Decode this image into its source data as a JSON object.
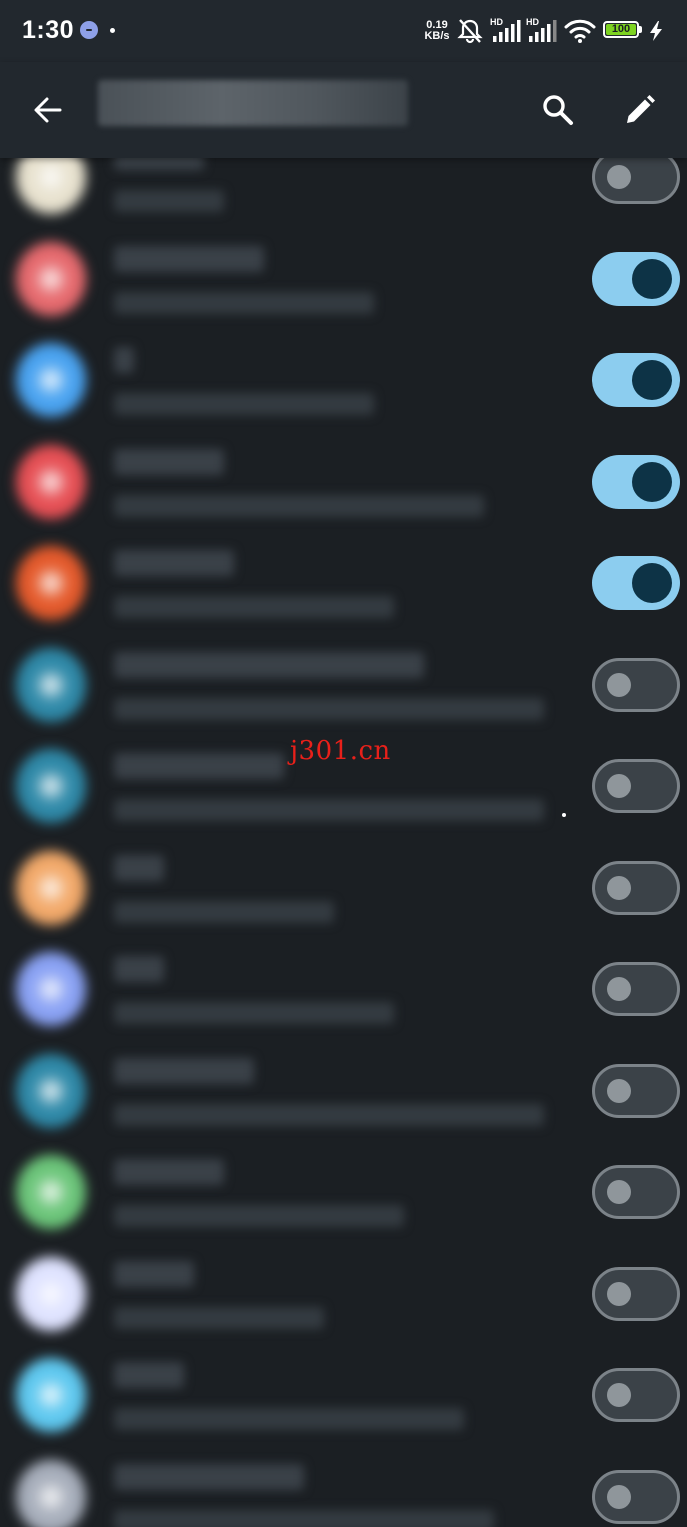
{
  "status_bar": {
    "time": "1:30",
    "net_speed_value": "0.19",
    "net_speed_unit": "KB/s",
    "battery_level": "100",
    "battery_level_percent": 100,
    "icons": [
      "notification-icon",
      "mute-icon",
      "hd-signal-icon",
      "hd-signal-icon",
      "wifi-icon",
      "battery-icon",
      "charging-icon"
    ]
  },
  "app_bar": {
    "title": "",
    "back_icon": "arrow-back-icon",
    "search_icon": "search-icon",
    "edit_icon": "pencil-icon"
  },
  "list": {
    "items": [
      {
        "name": "",
        "subtitle": "",
        "icon_color": "#e8e2cf",
        "enabled": false
      },
      {
        "name": "",
        "subtitle": "",
        "icon_color": "#e66a6e",
        "enabled": true
      },
      {
        "name": "",
        "subtitle": "",
        "icon_color": "#4aa3f0",
        "enabled": true
      },
      {
        "name": "",
        "subtitle": "",
        "icon_color": "#e65055",
        "enabled": true
      },
      {
        "name": "",
        "subtitle": "",
        "icon_color": "#e45a2c",
        "enabled": true
      },
      {
        "name": "",
        "subtitle": "",
        "icon_color": "#2f89a8",
        "enabled": false
      },
      {
        "name": "",
        "subtitle": "",
        "icon_color": "#2f89a8",
        "enabled": false
      },
      {
        "name": "",
        "subtitle": "",
        "icon_color": "#f2a96a",
        "enabled": false
      },
      {
        "name": "",
        "subtitle": "",
        "icon_color": "#8aa2f4",
        "enabled": false
      },
      {
        "name": "",
        "subtitle": "",
        "icon_color": "#2f89a8",
        "enabled": false
      },
      {
        "name": "",
        "subtitle": "",
        "icon_color": "#6cc57a",
        "enabled": false
      },
      {
        "name": "",
        "subtitle": "",
        "icon_color": "#dfe3ff",
        "enabled": false
      },
      {
        "name": "",
        "subtitle": "",
        "icon_color": "#5fc8ef",
        "enabled": false
      },
      {
        "name": "",
        "subtitle": "",
        "icon_color": "#a7aebb",
        "enabled": false
      }
    ]
  },
  "watermark": {
    "text": "j301.cn"
  },
  "colors": {
    "background": "#1b1f23",
    "app_bar": "#22282e",
    "toggle_on_track": "#8ccdef",
    "toggle_on_knob": "#0d3346",
    "toggle_off_track": "#3b4248",
    "toggle_off_border": "#7c8389",
    "watermark": "#e8201a",
    "battery_fill": "#7ed321"
  }
}
